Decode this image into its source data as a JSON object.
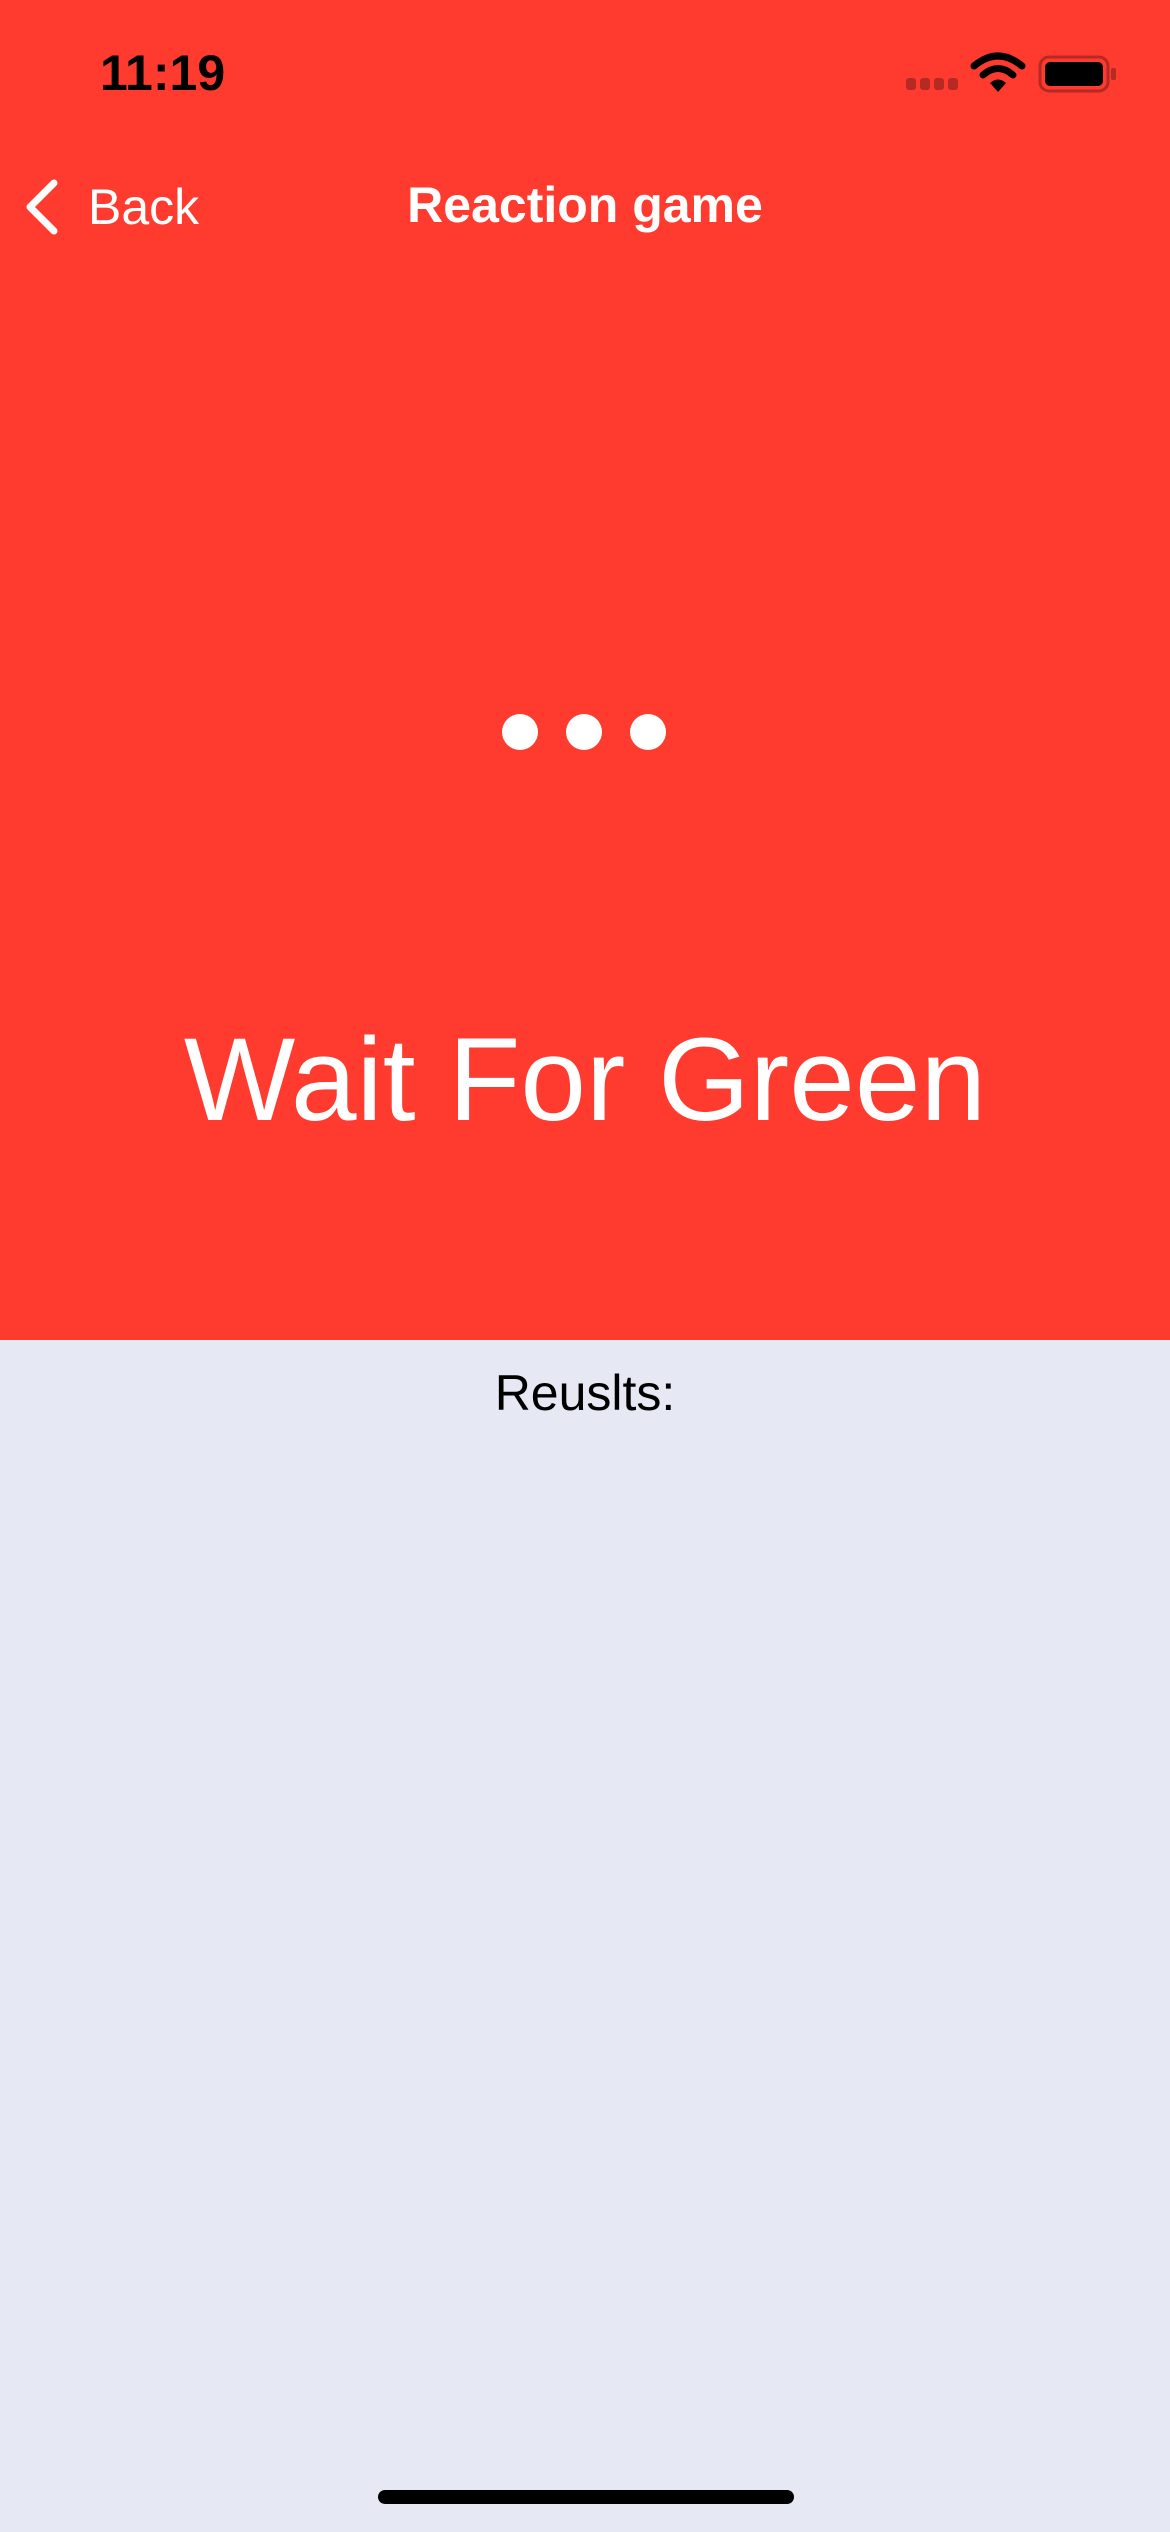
{
  "status_bar": {
    "time": "11:19",
    "icons": [
      "cellular-signal-icon",
      "wifi-icon",
      "battery-icon"
    ]
  },
  "nav": {
    "back_label": "Back",
    "back_icon": "chevron-left-icon",
    "title": "Reaction game"
  },
  "game": {
    "indicator_icon": "ellipsis-icon",
    "prompt": "Wait For Green",
    "background_color": "#FF3B30"
  },
  "results": {
    "label": "Reuslts:",
    "background_color": "#E6E9F4"
  }
}
